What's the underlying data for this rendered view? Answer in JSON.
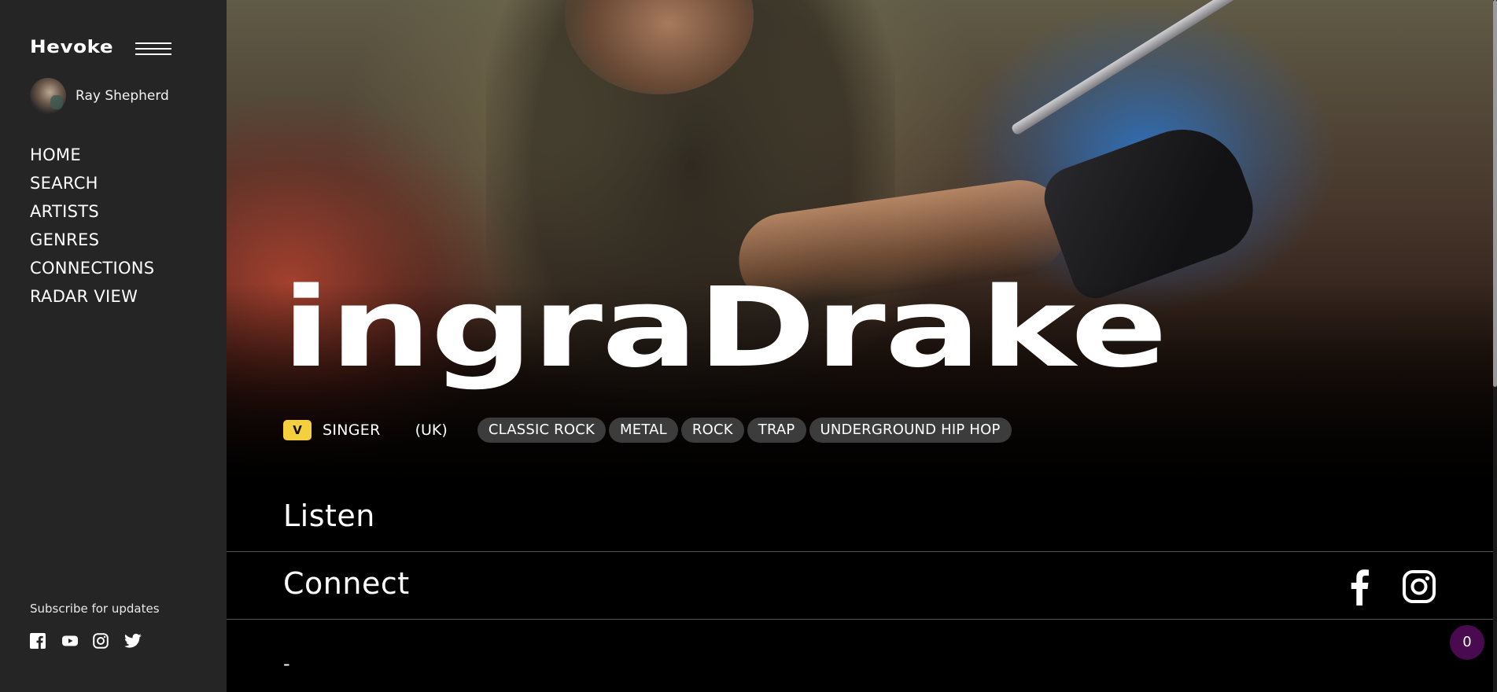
{
  "sidebar": {
    "logo": "Hevoke",
    "menu_icon": "hamburger-icon",
    "user": {
      "name": "Ray Shepherd"
    },
    "nav": [
      "HOME",
      "SEARCH",
      "ARTISTS",
      "GENRES",
      "CONNECTIONS",
      "RADAR VIEW"
    ],
    "subscribe_label": "Subscribe for updates",
    "social_icons": [
      "facebook-icon",
      "youtube-icon",
      "instagram-icon",
      "twitter-icon"
    ]
  },
  "artist": {
    "name": "ingraDrake",
    "verified_label": "V",
    "role": "SINGER",
    "country": "(UK)",
    "genres": [
      "CLASSIC ROCK",
      "METAL",
      "ROCK",
      "TRAP",
      "UNDERGROUND HIP HOP"
    ]
  },
  "sections": {
    "listen": "Listen",
    "connect": "Connect",
    "connect_icons": [
      "facebook-icon",
      "instagram-icon"
    ],
    "placeholder": "-"
  },
  "badge": {
    "count": "0"
  },
  "colors": {
    "sidebar_bg": "#252525",
    "main_bg": "#000000",
    "verified_bg": "#f4d03f",
    "pill_bg": "#464646",
    "badge_bg": "#4a0a50"
  }
}
